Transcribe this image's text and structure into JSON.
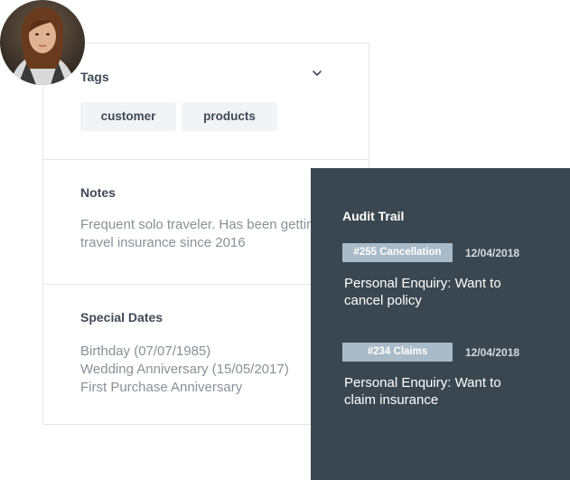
{
  "tags": {
    "title": "Tags",
    "items": [
      "customer",
      "products"
    ]
  },
  "notes": {
    "title": "Notes",
    "lines": [
      "Frequent solo traveler. Has been getting",
      "travel insurance since 2016"
    ]
  },
  "special_dates": {
    "title": "Special Dates",
    "lines": [
      "Birthday (07/07/1985)",
      "Wedding Anniversary (15/05/2017)",
      "First Purchase Anniversary"
    ]
  },
  "audit_trail": {
    "title": "Audit Trail",
    "entries": [
      {
        "badge": "#255 Cancellation",
        "date": "12/04/2018",
        "lines": [
          "Personal Enquiry: Want to",
          "cancel policy"
        ]
      },
      {
        "badge": "#234 Claims",
        "date": "12/04/2018",
        "lines": [
          "Personal Enquiry: Want to",
          "claim insurance"
        ]
      }
    ]
  },
  "icons": {
    "chevron": "chevron-down-icon",
    "avatar": "user-avatar"
  },
  "colors": {
    "panel": "#3b4750",
    "badge": "#a9bbc9",
    "tag_bg": "#f1f3f6",
    "heading": "#3f4a57",
    "muted": "#8a9098"
  }
}
